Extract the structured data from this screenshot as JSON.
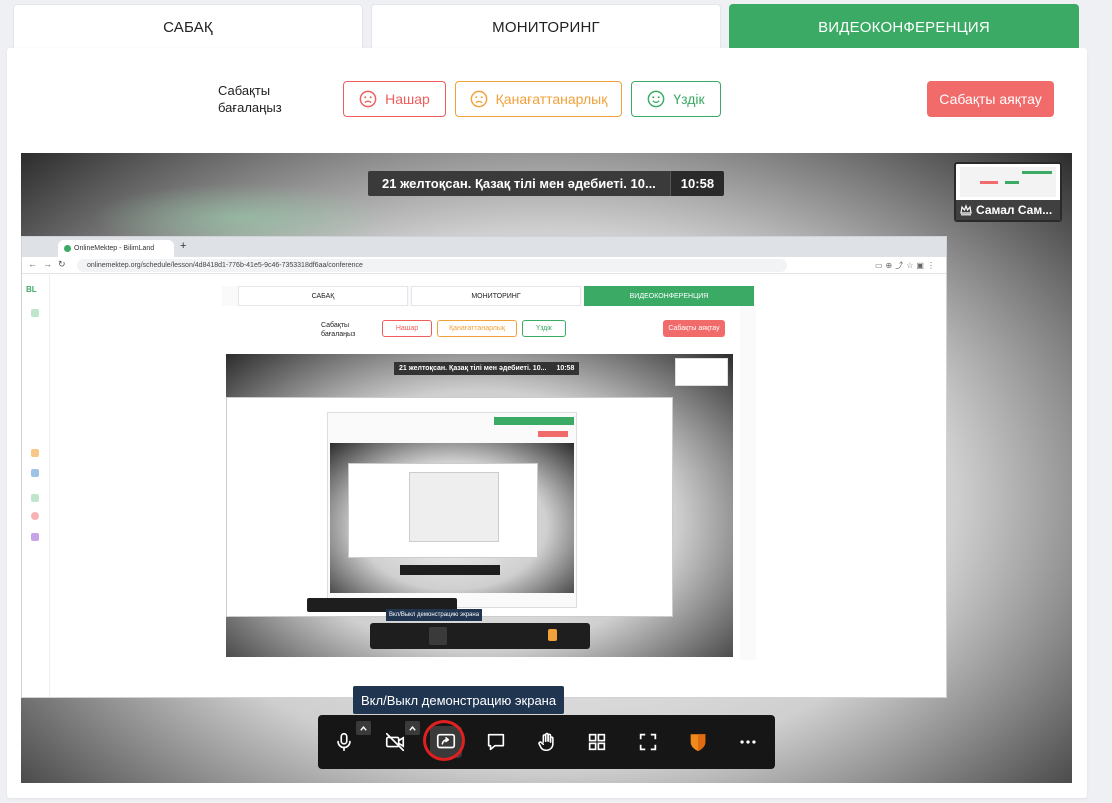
{
  "tabs": [
    {
      "label": "САБАҚ"
    },
    {
      "label": "МОНИТОРИНГ"
    },
    {
      "label": "ВИДЕОКОНФЕРЕНЦИЯ"
    }
  ],
  "rating": {
    "label": "Сабақты бағалаңыз",
    "bad": "Нашар",
    "ok": "Қанағаттанарлық",
    "good": "Үздік"
  },
  "end_button": "Сабақты аяқтау",
  "meeting": {
    "title": "21 желтоқсан. Қазақ тілі мен әдебиеті. 10...",
    "time": "10:58"
  },
  "participant": {
    "name": "Самал Сам..."
  },
  "browser": {
    "tab_title": "OnlineMektep - BilimLand",
    "url": "onlinemektep.org/schedule/lesson/4d8418d1-776b-41e5-9c46-7353318df6aa/conference",
    "logo": "BL"
  },
  "tooltip": "Вкл/Выкл демонстрацию экрана",
  "controls": {
    "mic": "microphone-icon",
    "camera": "camera-off-icon",
    "screen": "screen-share-icon",
    "chat": "chat-icon",
    "hand": "raise-hand-icon",
    "tiles": "grid-view-icon",
    "fullscreen": "fullscreen-icon",
    "security": "shield-icon",
    "more": "more-icon"
  },
  "colors": {
    "accent_green": "#3aaa64",
    "danger_red": "#f26b6b",
    "warning_orange": "#f1a13a",
    "tooltip_bg": "#1f3550",
    "highlight": "#e02020"
  }
}
